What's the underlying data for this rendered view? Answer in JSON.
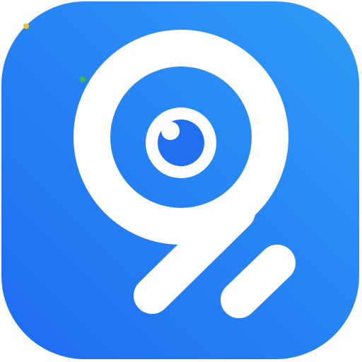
{
  "app_icon": {
    "icon_name": "camera-lens-logo-icon",
    "colors": {
      "gradient_start": "#1F6BF0",
      "gradient_end": "#2E9CF8",
      "glyph": "#FFFFFF",
      "lens_pupil": "#1F6FEF"
    }
  },
  "artifacts": {
    "yellow_dot_color": "#E4C52A",
    "green_dot_color": "#3DBA4A"
  }
}
